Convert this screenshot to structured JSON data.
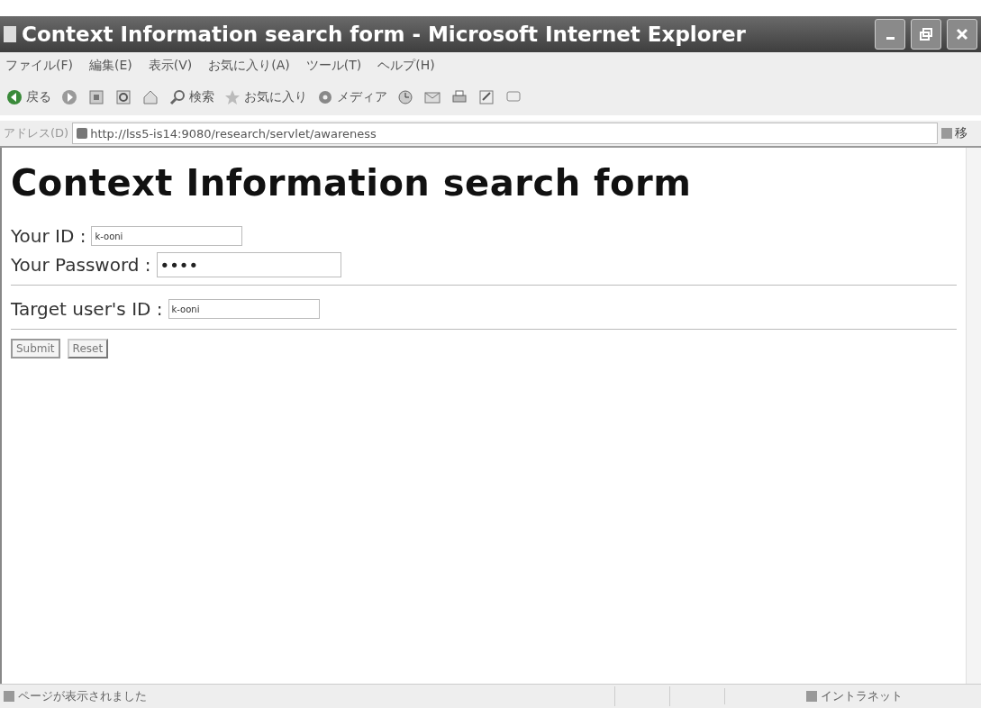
{
  "window": {
    "title": "Context Information search form - Microsoft Internet Explorer"
  },
  "menu": [
    "ファイル(F)",
    "編集(E)",
    "表示(V)",
    "お気に入り(A)",
    "ツール(T)",
    "ヘルプ(H)"
  ],
  "toolbar": [
    {
      "kind": "back",
      "label": "戻る"
    },
    {
      "kind": "forward"
    },
    {
      "kind": "stop"
    },
    {
      "kind": "refresh"
    },
    {
      "kind": "home"
    },
    {
      "kind": "search",
      "label": "検索"
    },
    {
      "kind": "favorites",
      "label": "お気に入り"
    },
    {
      "kind": "media",
      "label": "メディア"
    },
    {
      "kind": "history"
    },
    {
      "kind": "mail"
    },
    {
      "kind": "print"
    },
    {
      "kind": "edit"
    },
    {
      "kind": "discuss"
    }
  ],
  "address": {
    "label": "アドレス(D)",
    "url": "http://lss5-is14:9080/research/servlet/awareness",
    "go": "移"
  },
  "page": {
    "heading": "Context Information search form",
    "login_fields": [
      {
        "label": "Your ID :",
        "value": "k-ooni",
        "kind": "text"
      },
      {
        "label": "Your Password :",
        "value": "••••",
        "kind": "password"
      }
    ],
    "target_fields": [
      {
        "label": "Target user's ID :",
        "value": "k-ooni",
        "kind": "text"
      }
    ],
    "buttons": [
      "Submit",
      "Reset"
    ]
  },
  "status_bar": {
    "message": "ページが表示されました",
    "zone": "イントラネット"
  }
}
